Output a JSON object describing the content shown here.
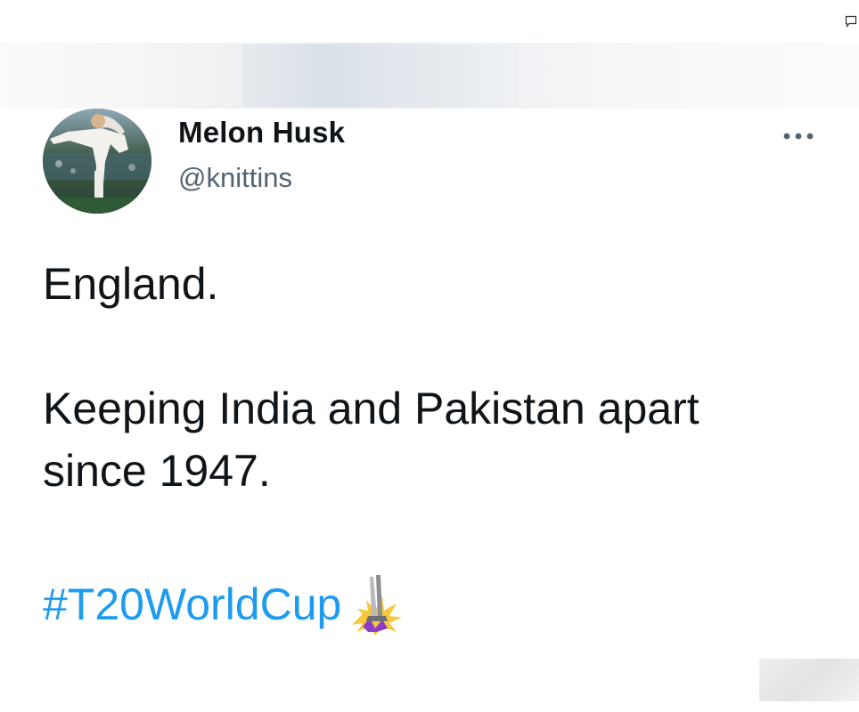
{
  "author": {
    "display_name": "Melon Husk",
    "handle": "@knittins"
  },
  "tweet": {
    "lines": [
      "England.",
      "Keeping India and Pakistan apart",
      "since 1947."
    ],
    "hashtag": "#T20WorldCup"
  },
  "icons": {
    "more": "more-horizontal-icon",
    "hashtag_emoji": "t20-trophy-icon",
    "corner": "comment-icon"
  },
  "colors": {
    "text": "#0f1419",
    "secondary_text": "#536471",
    "link": "#1d9bf0",
    "background": "#ffffff"
  }
}
